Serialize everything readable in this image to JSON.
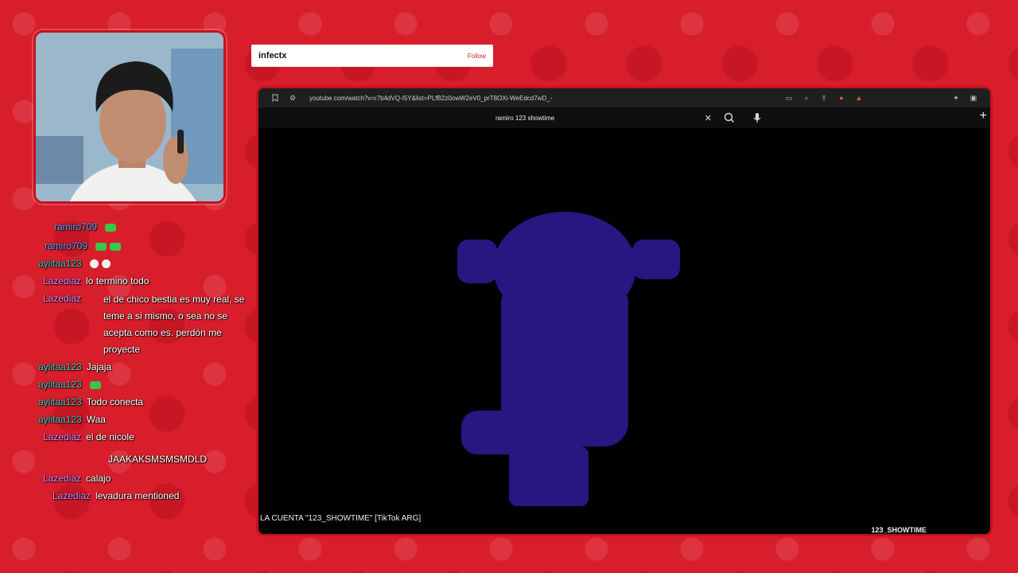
{
  "follow": {
    "name": "infectx",
    "button": "Follow"
  },
  "browser": {
    "url": "youtube.com/watch?v=r7b4dVQ-I5Y&list=PLfB2z0owW2eV0_prT8OXi-WeEdcd7wD_-",
    "search_query": "ramiro 123 showtime",
    "video_title": "LA CUENTA \"123_SHOWTIME\" [TikTok ARG]",
    "channel": "123_SHOWTIME"
  },
  "chat": [
    {
      "user": "ramiro709",
      "text": "",
      "color": "#5aa7ff"
    },
    {
      "user": "ramiro709",
      "text": "",
      "color": "#5aa7ff"
    },
    {
      "user": "ayiitaa123",
      "text": "",
      "color": "#46c7c2"
    },
    {
      "user": "Lazediaz",
      "text": "lo termino todo",
      "color": "#d98bff"
    },
    {
      "user": "Lazediaz",
      "text": "el de chico bestia es muy real, se teme a si mismo, o sea no se acepta como es. perdón me proyecte",
      "color": "#d98bff"
    },
    {
      "user": "ayiitaa123",
      "text": "Jajaja",
      "color": "#46c7c2"
    },
    {
      "user": "ayiitaa123",
      "text": "",
      "color": "#46c7c2"
    },
    {
      "user": "ayiitaa123",
      "text": "Todo conecta",
      "color": "#46c7c2"
    },
    {
      "user": "ayiitaa123",
      "text": "Waa",
      "color": "#46c7c2"
    },
    {
      "user": "Lazediaz",
      "text": "el de nicole",
      "color": "#d98bff"
    },
    {
      "user": "",
      "text": "JAAKAKSMSMSMDLD",
      "color": "#d98bff"
    },
    {
      "user": "Lazediaz",
      "text": "calajo",
      "color": "#d98bff"
    },
    {
      "user": "Lazediaz",
      "text": "levadura mentioned",
      "color": "#d98bff"
    }
  ]
}
